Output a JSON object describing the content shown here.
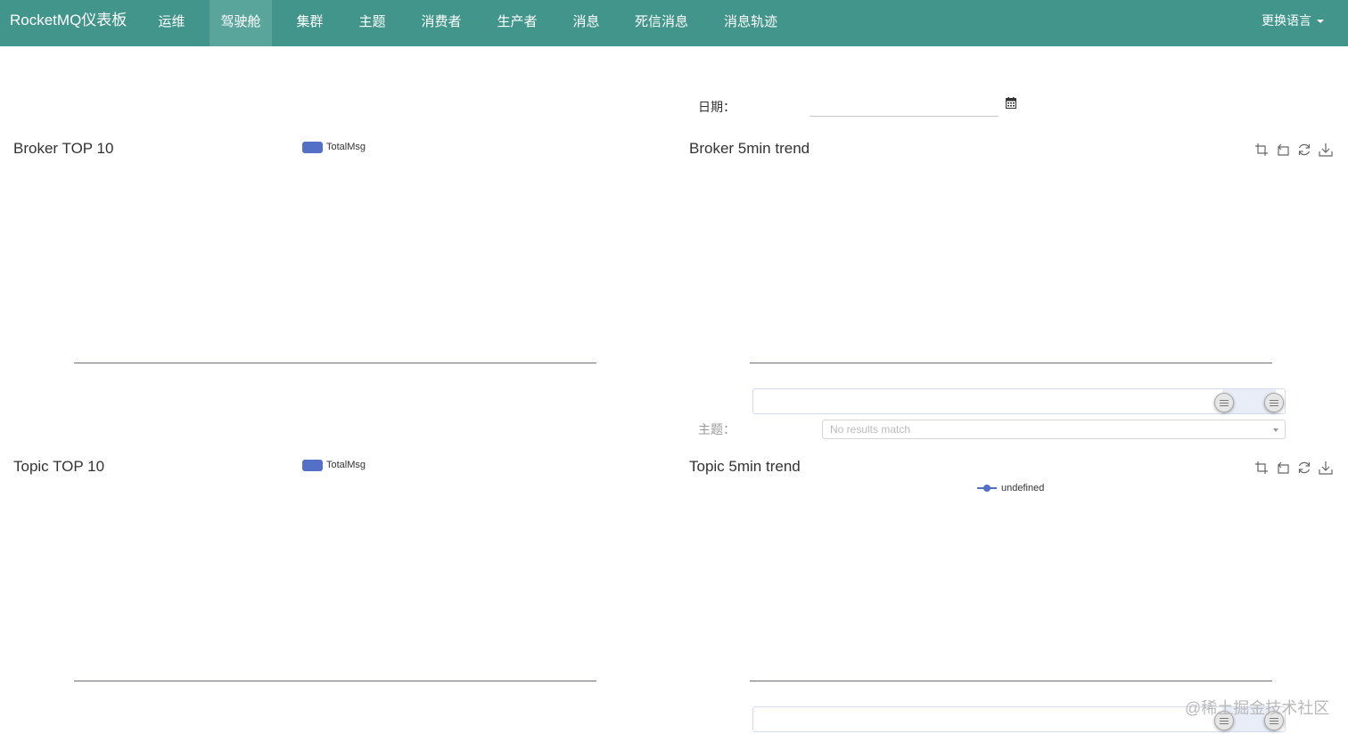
{
  "navbar": {
    "brand": "RocketMQ仪表板",
    "items": [
      {
        "label": "运维"
      },
      {
        "label": "驾驶舱"
      },
      {
        "label": "集群"
      },
      {
        "label": "主题"
      },
      {
        "label": "消费者"
      },
      {
        "label": "生产者"
      },
      {
        "label": "消息"
      },
      {
        "label": "死信消息"
      },
      {
        "label": "消息轨迹"
      }
    ],
    "active_item": "驾驶舱",
    "language_label": "更换语言",
    "accent_color": "#41958a"
  },
  "date_filter": {
    "label": "日期：",
    "value": ""
  },
  "broker_top10": {
    "title": "Broker TOP 10",
    "legend": "TotalMsg"
  },
  "broker_trend": {
    "title": "Broker 5min trend"
  },
  "topic_filter": {
    "label": "主题：",
    "placeholder": "No results match"
  },
  "topic_top10": {
    "title": "Topic TOP 10",
    "legend": "TotalMsg"
  },
  "topic_trend": {
    "title": "Topic 5min trend",
    "legend": "undefined"
  },
  "toolbox_icons": [
    "zoom-icon",
    "zoom-reset-icon",
    "restore-icon",
    "save-image-icon"
  ],
  "series_color": "#5470c6",
  "watermark": "@稀土掘金技术社区"
}
